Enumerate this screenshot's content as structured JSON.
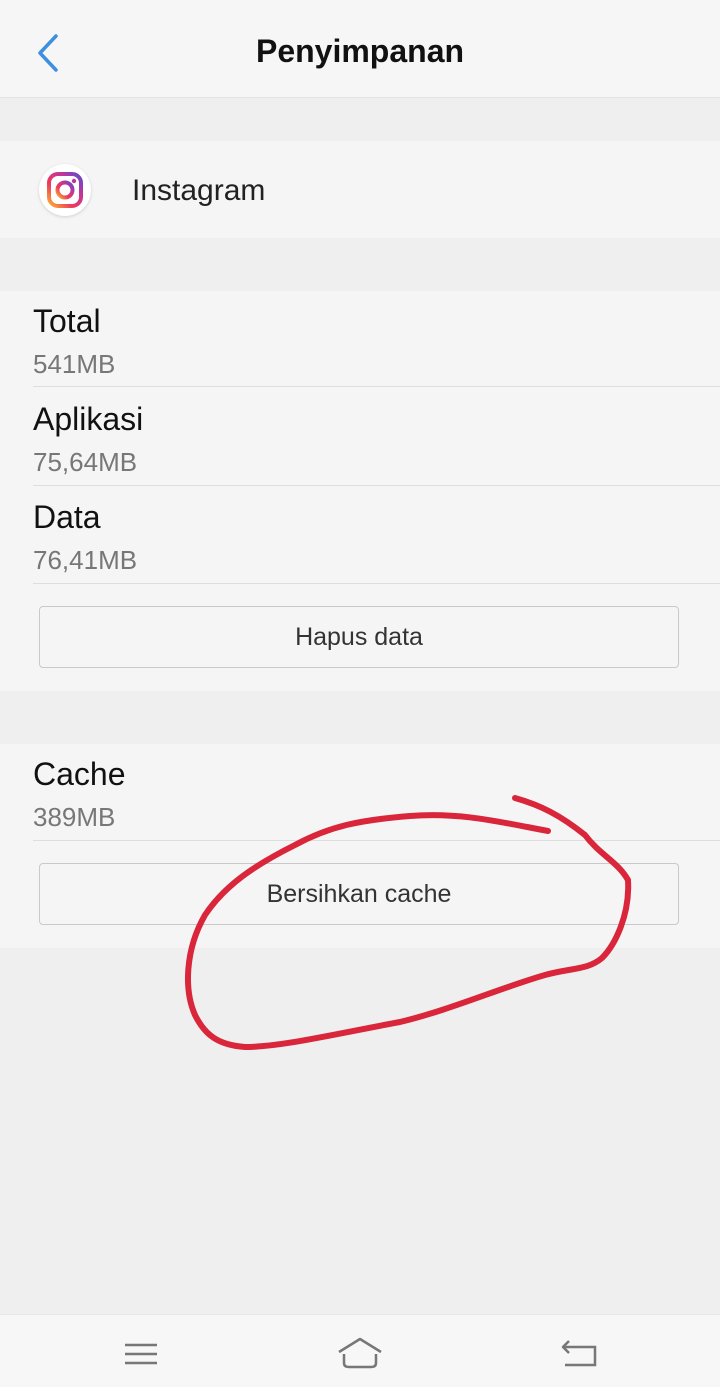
{
  "header": {
    "title": "Penyimpanan",
    "back_icon": "chevron-left-icon"
  },
  "app": {
    "name": "Instagram",
    "icon": "instagram-logo"
  },
  "storage": {
    "rows": [
      {
        "label": "Total",
        "value": "541MB"
      },
      {
        "label": "Aplikasi",
        "value": "75,64MB"
      },
      {
        "label": "Data",
        "value": "76,41MB"
      }
    ],
    "clear_data_label": "Hapus data"
  },
  "cache": {
    "label": "Cache",
    "value": "389MB",
    "clear_cache_label": "Bersihkan cache"
  },
  "navbar": {
    "icons": [
      "menu-icon",
      "home-icon",
      "back-icon"
    ]
  },
  "colors": {
    "accent": "#3d8fe0",
    "annotation": "#d9263a"
  }
}
